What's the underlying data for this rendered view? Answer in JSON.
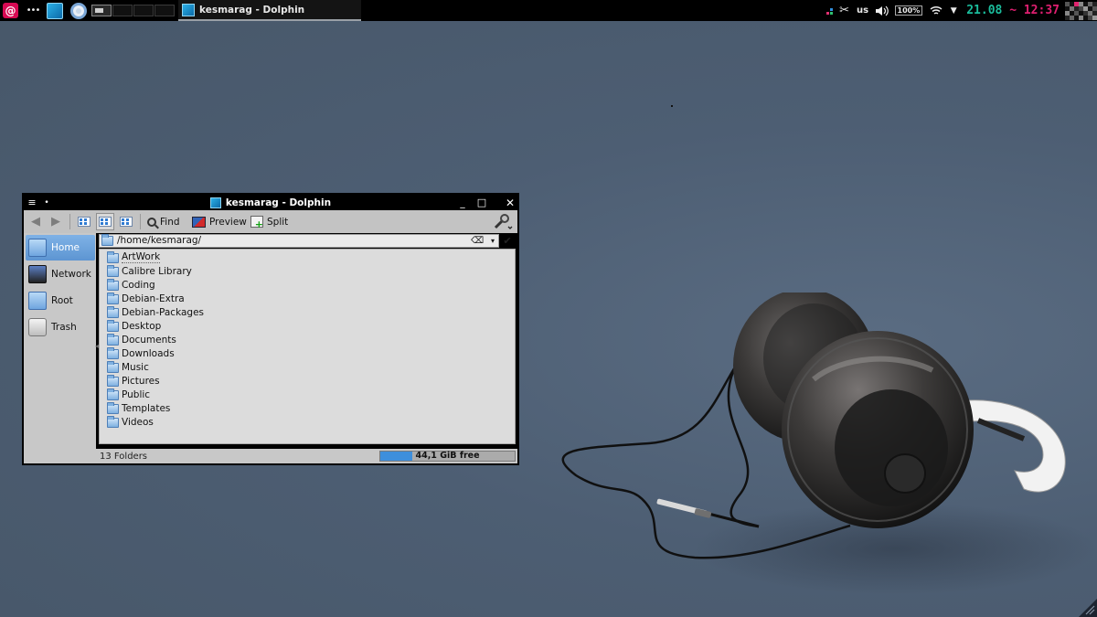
{
  "panel": {
    "menu_label": "@",
    "dots": "•••",
    "launchers": [
      "dolphin-launcher",
      "chromium-launcher"
    ],
    "task_title": "kesmarag - Dolphin",
    "keyboard_layout": "us",
    "battery": "100%",
    "clock": {
      "date": "21.08",
      "separator": "~",
      "time": "12:37"
    },
    "colors": {
      "date": "#1bbd9c",
      "time": "#e01f70",
      "panel_bg": "#000000"
    }
  },
  "window": {
    "title": "kesmarag - Dolphin",
    "menu_glyph": "≡",
    "pin_glyph": "•",
    "min_glyph": "_",
    "max_glyph": "□",
    "close_glyph": "✕"
  },
  "toolbar": {
    "back_glyph": "◀",
    "forward_glyph": "▶",
    "find_label": "Find",
    "preview_label": "Preview",
    "split_label": "Split",
    "settings_glyph": "🔧"
  },
  "places": [
    {
      "label": "Home",
      "icon": "home-folder-icon"
    },
    {
      "label": "Network",
      "icon": "network-icon"
    },
    {
      "label": "Root",
      "icon": "root-folder-icon"
    },
    {
      "label": "Trash",
      "icon": "trash-icon"
    }
  ],
  "location": {
    "path": "/home/kesmarag/",
    "clear_glyph": "⌫",
    "dropdown_glyph": "▾",
    "confirm_glyph": "✔"
  },
  "folders": [
    "ArtWork",
    "Calibre Library",
    "Coding",
    "Debian-Extra",
    "Debian-Packages",
    "Desktop",
    "Documents",
    "Downloads",
    "Music",
    "Pictures",
    "Public",
    "Templates",
    "Videos"
  ],
  "status": {
    "summary": "13 Folders",
    "free_space": "44,1 GiB free",
    "used_fraction": 0.24,
    "accent": "#3e8fdc"
  }
}
